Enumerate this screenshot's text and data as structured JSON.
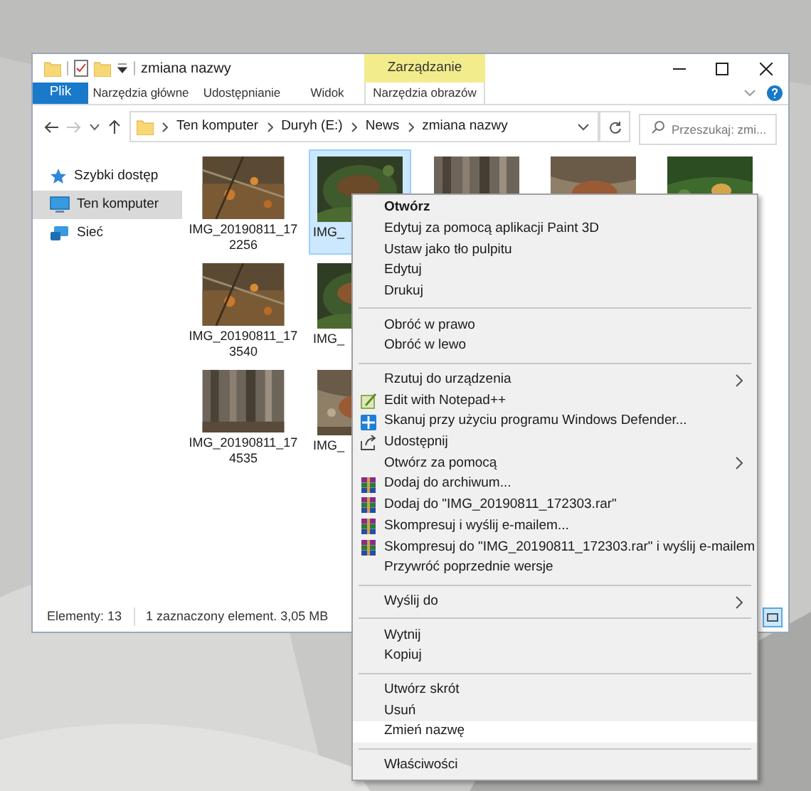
{
  "window": {
    "title": "zmiana nazwy",
    "contextual_group": "Zarządzanie"
  },
  "ribbon": {
    "file_tab": "Plik",
    "tabs": [
      {
        "label": "Narzędzia główne"
      },
      {
        "label": "Udostępnianie"
      },
      {
        "label": "Widok"
      },
      {
        "label": "Narzędzia obrazów",
        "contextual": true
      }
    ]
  },
  "address_bar": {
    "crumbs": [
      "Ten komputer",
      "Duryh (E:)",
      "News",
      "zmiana nazwy"
    ],
    "search_placeholder": "Przeszukaj: zmi..."
  },
  "sidebar": {
    "items": [
      {
        "label": "Szybki dostęp",
        "kind": "star",
        "selected": false
      },
      {
        "label": "Ten komputer",
        "kind": "pc",
        "selected": true
      },
      {
        "label": "Sieć",
        "kind": "network",
        "selected": false
      }
    ]
  },
  "files": {
    "rows": [
      [
        {
          "kind": "file",
          "lines": [
            "IMG_20190811_17",
            "2256"
          ],
          "selected": false
        },
        {
          "kind": "file",
          "lines": [
            "IMG_"
          ],
          "selected": true
        },
        {
          "kind": "picture"
        },
        {
          "kind": "picture"
        },
        {
          "kind": "picture"
        }
      ],
      [
        {
          "kind": "file",
          "lines": [
            "IMG_20190811_17",
            "3540"
          ],
          "selected": false
        },
        {
          "kind": "file",
          "lines": [
            "IMG_"
          ],
          "selected": false
        }
      ],
      [
        {
          "kind": "file",
          "lines": [
            "IMG_20190811_17",
            "4535"
          ],
          "selected": false
        },
        {
          "kind": "file",
          "lines": [
            "IMG_"
          ],
          "selected": false
        }
      ]
    ]
  },
  "status_bar": {
    "count": "Elementy: 13",
    "selection": "1 zaznaczony element. 3,05 MB",
    "view_toggle_selected": true
  },
  "context_menu": {
    "items": [
      {
        "kind": "item",
        "label": "Otwórz",
        "default": true,
        "selected": false
      },
      {
        "kind": "item",
        "label": "Edytuj za pomocą aplikacji Paint 3D",
        "selected": false
      },
      {
        "kind": "item",
        "label": "Ustaw jako tło pulpitu",
        "selected": false
      },
      {
        "kind": "item",
        "label": "Edytuj",
        "selected": false
      },
      {
        "kind": "item",
        "label": "Drukuj",
        "selected": false
      },
      {
        "kind": "separator"
      },
      {
        "kind": "item",
        "label": "Obróć w prawo",
        "selected": false
      },
      {
        "kind": "item",
        "label": "Obróć w lewo",
        "selected": false
      },
      {
        "kind": "separator"
      },
      {
        "kind": "item",
        "label": "Rzutuj do urządzenia",
        "submenu": true,
        "selected": false
      },
      {
        "kind": "notepad",
        "label": "Edit with Notepad++",
        "selected": false
      },
      {
        "kind": "defender",
        "label": "Skanuj przy użyciu programu Windows Defender...",
        "selected": false
      },
      {
        "kind": "share",
        "label": "Udostępnij",
        "selected": false
      },
      {
        "kind": "item",
        "label": "Otwórz za pomocą",
        "submenu": true,
        "selected": false
      },
      {
        "kind": "archive",
        "label": "Dodaj do archiwum...",
        "selected": false
      },
      {
        "kind": "archive",
        "label": "Dodaj do \"IMG_20190811_172303.rar\"",
        "selected": false
      },
      {
        "kind": "archive",
        "label": "Skompresuj i wyślij e-mailem...",
        "selected": false
      },
      {
        "kind": "archive",
        "label": "Skompresuj do \"IMG_20190811_172303.rar\" i wyślij e-mailem",
        "selected": false
      },
      {
        "kind": "item",
        "label": "Przywróć poprzednie wersje",
        "selected": false
      },
      {
        "kind": "separator"
      },
      {
        "kind": "item",
        "label": "Wyślij do",
        "submenu": true,
        "selected": false
      },
      {
        "kind": "separator"
      },
      {
        "kind": "item",
        "label": "Wytnij",
        "selected": false
      },
      {
        "kind": "item",
        "label": "Kopiuj",
        "selected": false
      },
      {
        "kind": "separator"
      },
      {
        "kind": "item",
        "label": "Utwórz skrót",
        "selected": false
      },
      {
        "kind": "item",
        "label": "Usuń",
        "selected": false
      },
      {
        "kind": "item",
        "label": "Zmień nazwę",
        "selected": true
      },
      {
        "kind": "separator"
      },
      {
        "kind": "item",
        "label": "Właściwości",
        "selected": false
      }
    ]
  }
}
